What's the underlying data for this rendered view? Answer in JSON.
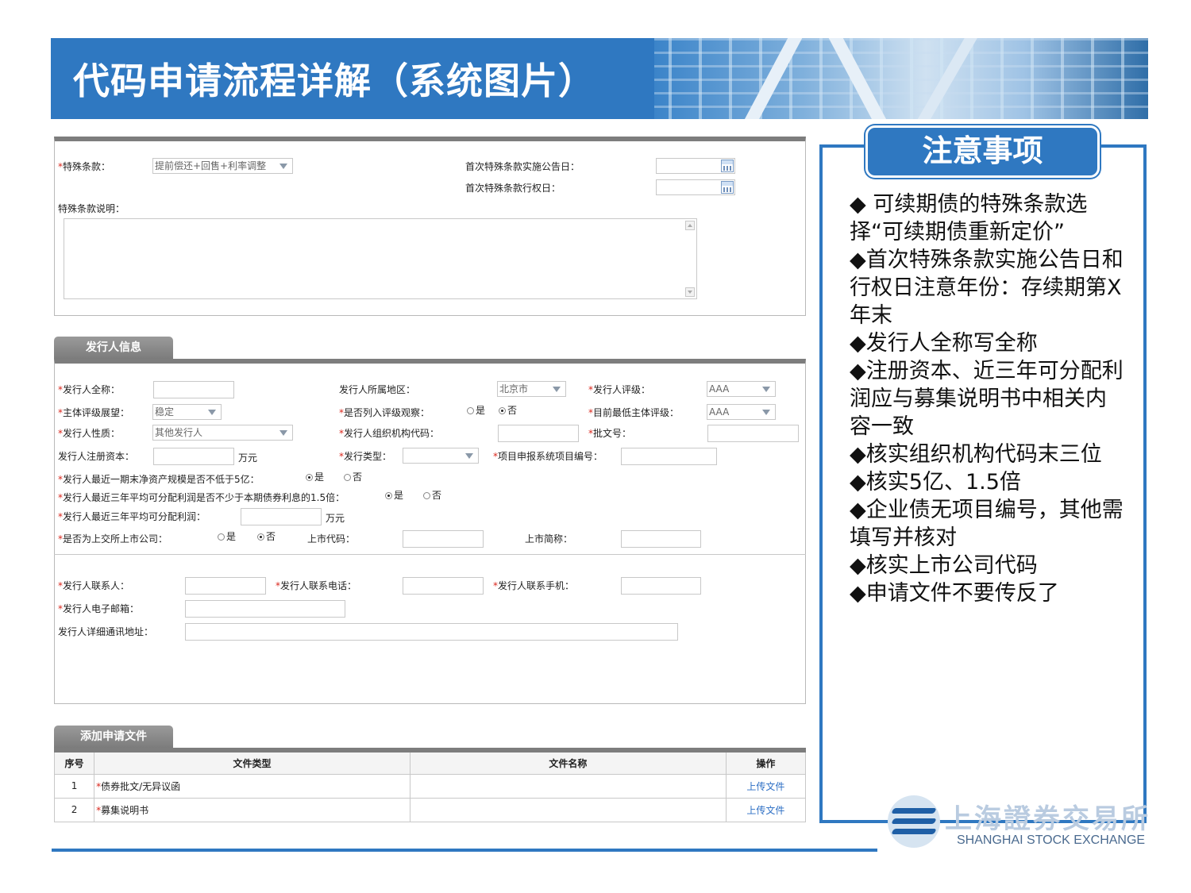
{
  "banner": {
    "title": "代码申请流程详解（系统图片）"
  },
  "special_terms": {
    "label": "特殊条款：",
    "value": "提前偿还+回售+利率调整",
    "announce_date_label": "首次特殊条款实施公告日：",
    "exercise_date_label": "首次特殊条款行权日：",
    "desc_label": "特殊条款说明："
  },
  "issuer": {
    "tab_label": "发行人信息",
    "full_name_label": "发行人全称：",
    "region_label": "发行人所属地区：",
    "region_value": "北京市",
    "rating_label": "发行人评级：",
    "rating_value": "AAA",
    "outlook_label": "主体评级展望：",
    "outlook_value": "稳定",
    "watch_label": "是否列入评级观察：",
    "yes": "是",
    "no": "否",
    "lowest_rating_label": "目前最低主体评级：",
    "lowest_rating_value": "AAA",
    "nature_label": "发行人性质：",
    "nature_value": "其他发行人",
    "org_code_label": "发行人组织机构代码：",
    "approval_label": "批文号：",
    "capital_label": "发行人注册资本：",
    "unit": "万元",
    "issue_type_label": "发行类型：",
    "project_no_label": "项目申报系统项目编号：",
    "net_assets_label": "发行人最近一期末净资产规模是否不低于5亿：",
    "avg_profit_check_label": "发行人最近三年平均可分配利润是否不少于本期债券利息的1.5倍：",
    "avg_profit_label": "发行人最近三年平均可分配利润：",
    "listed_label": "是否为上交所上市公司：",
    "listed_code_label": "上市代码：",
    "listed_abbr_label": "上市简称：",
    "contact_label": "发行人联系人：",
    "phone_label": "发行人联系电话：",
    "mobile_label": "发行人联系手机：",
    "email_label": "发行人电子邮箱：",
    "address_label": "发行人详细通讯地址："
  },
  "files": {
    "tab_label": "添加申请文件",
    "headers": [
      "序号",
      "文件类型",
      "文件名称",
      "操作"
    ],
    "rows": [
      {
        "no": "1",
        "type": "债券批文/无异议函",
        "name": "",
        "op": "上传文件"
      },
      {
        "no": "2",
        "type": "募集说明书",
        "name": "",
        "op": "上传文件"
      }
    ]
  },
  "notes": {
    "title": "注意事项",
    "items": [
      "◆  可续期债的特殊条款选择“可续期债重新定价”",
      "◆首次特殊条款实施公告日和行权日注意年份：存续期第X年末",
      "◆发行人全称写全称",
      "◆注册资本、近三年可分配利润应与募集说明书中相关内容一致",
      "◆核实组织机构代码末三位",
      "◆核实5亿、1.5倍",
      "◆企业债无项目编号，其他需填写并核对",
      "◆核实上市公司代码",
      "◆申请文件不要传反了"
    ]
  },
  "footer": {
    "logo_cn": "上海證券交易所",
    "logo_en": "SHANGHAI STOCK EXCHANGE"
  },
  "colors": {
    "brand_blue": "#2f78c1",
    "required_star": "#d9261c",
    "link": "#2b6ec4"
  }
}
